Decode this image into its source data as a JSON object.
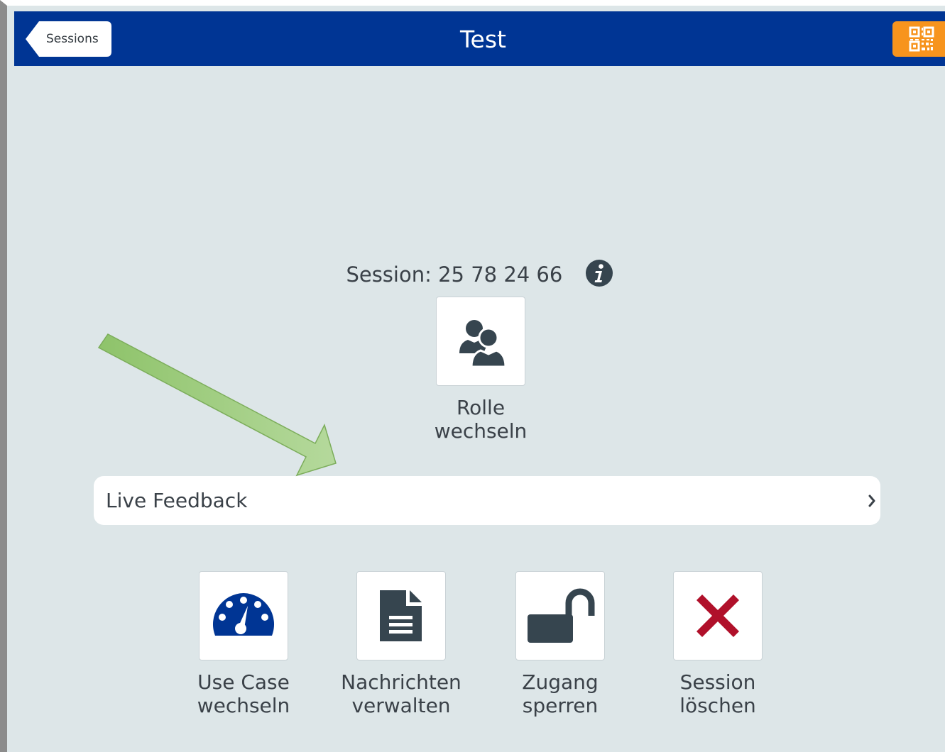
{
  "header": {
    "back_label": "Sessions",
    "title": "Test",
    "qr_icon": "qr-code-icon"
  },
  "session": {
    "label": "Session: 25 78 24 66",
    "info_icon": "info-icon"
  },
  "role_tile": {
    "line1": "Rolle",
    "line2": "wechseln",
    "icon": "users-icon"
  },
  "live_feedback": {
    "label": "Live Feedback",
    "icon": "chevron-right-icon"
  },
  "actions": [
    {
      "line1": "Use Case",
      "line2": "wechseln",
      "icon": "dashboard-gauge-icon"
    },
    {
      "line1": "Nachrichten",
      "line2": "verwalten",
      "icon": "document-icon"
    },
    {
      "line1": "Zugang",
      "line2": "sperren",
      "icon": "unlocked-padlock-icon"
    },
    {
      "line1": "Session",
      "line2": "löschen",
      "icon": "delete-x-icon"
    }
  ],
  "colors": {
    "header_bg": "#003594",
    "page_bg": "#dde6e8",
    "qr_button": "#f7941d",
    "icon_dark": "#36454f",
    "icon_blue": "#003594",
    "delete_red": "#b0102a",
    "annotation_arrow": "#a3cf85"
  }
}
